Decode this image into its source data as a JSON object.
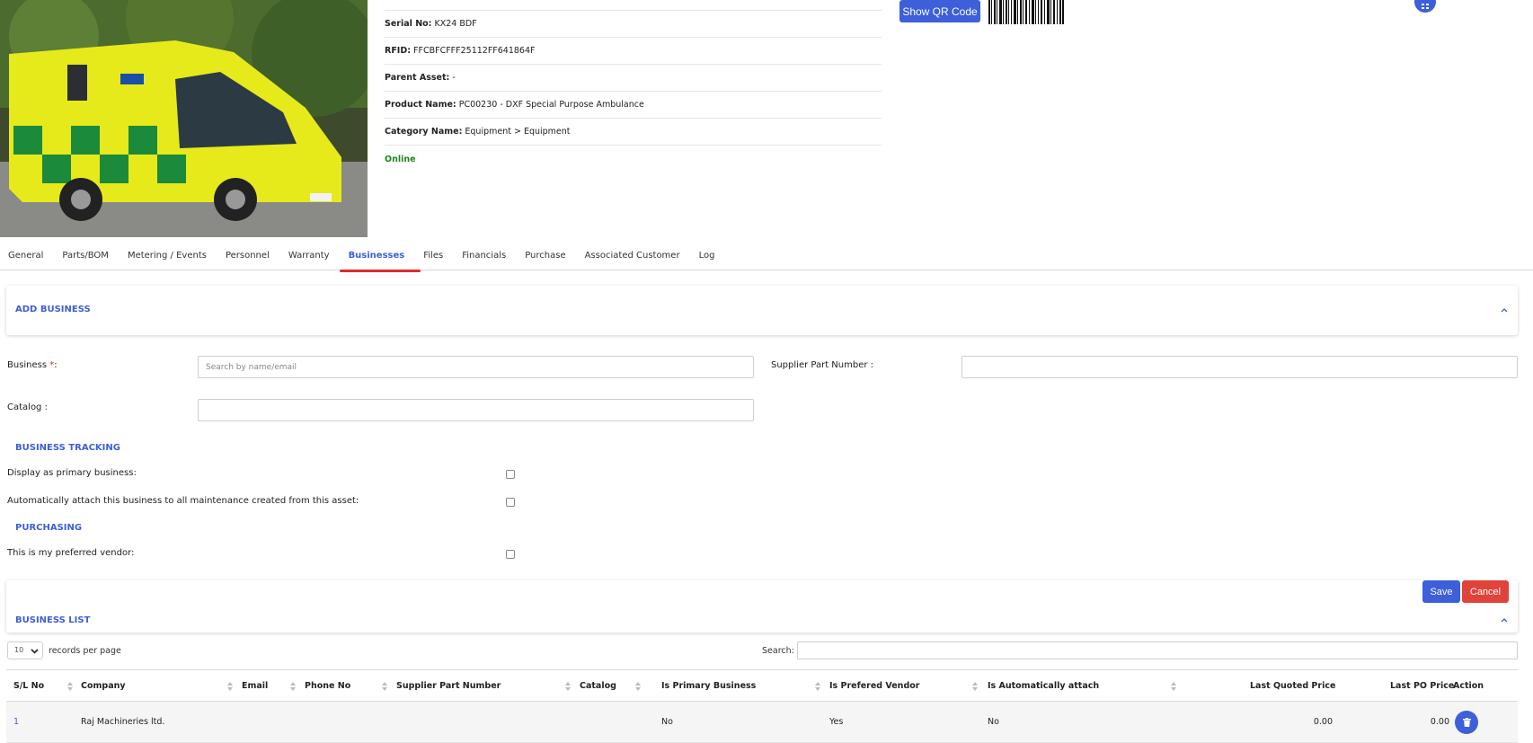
{
  "asset": {
    "photo_alt": "ambulance",
    "serial_label": "Serial No:",
    "serial_value": "KX24 BDF",
    "rfid_label": "RFID:",
    "rfid_value": "FFCBFCFFF25112FF641864F",
    "parent_label": "Parent Asset:",
    "parent_value": "-",
    "product_label": "Product Name:",
    "product_value": "PC00230 - DXF Special Purpose Ambulance",
    "category_label": "Category Name:",
    "category_value": "Equipment > Equipment",
    "status": "Online",
    "qr_button": "Show QR Code"
  },
  "tabs": [
    "General",
    "Parts/BOM",
    "Metering / Events",
    "Personnel",
    "Warranty",
    "Businesses",
    "Files",
    "Financials",
    "Purchase",
    "Associated Customer",
    "Log"
  ],
  "active_tab": "Businesses",
  "add_business": {
    "title": "ADD BUSINESS",
    "business_label": "Business ",
    "business_required": "*",
    "business_colon": ":",
    "business_placeholder": "Search by name/email",
    "supplier_label": "Supplier Part Number :",
    "catalog_label": "Catalog :"
  },
  "tracking": {
    "title": "BUSINESS TRACKING",
    "primary_label": "Display as primary business:",
    "auto_attach_label": "Automatically attach this business to all maintenance created from this asset:"
  },
  "purchasing": {
    "title": "PURCHASING",
    "preferred_label": "This is my preferred vendor:"
  },
  "actions": {
    "save": "Save",
    "cancel": "Cancel"
  },
  "business_list": {
    "title": "BUSINESS LIST",
    "per_page": "10",
    "per_page_label": "records per page",
    "search_label": "Search:",
    "columns": [
      "S/L No",
      "Company",
      "Email",
      "Phone No",
      "Supplier Part Number",
      "Catalog",
      "Is Primary Business",
      "Is Prefered Vendor",
      "Is Automatically attach",
      "Last Quoted Price",
      "Last PO Price",
      "Action"
    ],
    "rows": [
      {
        "sl": "1",
        "company": "Raj Machineries ltd.",
        "email": "",
        "phone": "",
        "supplier_part": "",
        "catalog": "",
        "is_primary": "No",
        "is_preferred": "Yes",
        "is_auto": "No",
        "last_quoted": "0.00",
        "last_po": "0.00"
      }
    ]
  },
  "colors": {
    "accent": "#3d5fd9",
    "danger": "#e0433a",
    "online": "#1a8a1a"
  }
}
